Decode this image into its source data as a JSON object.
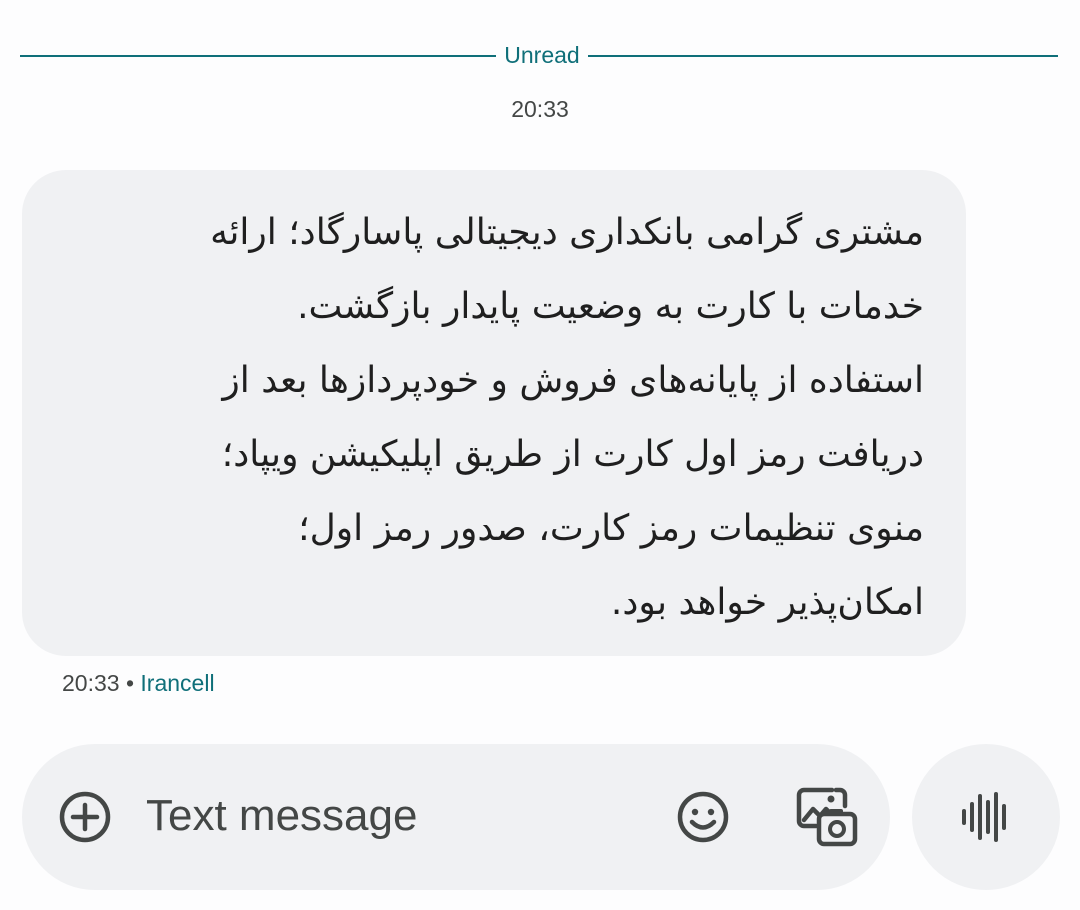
{
  "divider": {
    "label": "Unread"
  },
  "conversation": {
    "timestamp": "20:33",
    "message": {
      "text": "مشتری گرامی بانکداری دیجیتالی پاسارگاد؛ ارائه\nخدمات با کارت به وضعیت پایدار بازگشت.\nاستفاده از پایانه‌های فروش و خودپردازها بعد از\nدریافت رمز اول کارت از طریق اپلیکیشن ویپاد؛\nمنوی تنظیمات رمز کارت، صدور رمز اول؛\nامکان‌پذیر خواهد بود.",
      "time": "20:33",
      "separator": "•",
      "sender": "Irancell"
    }
  },
  "composer": {
    "placeholder": "Text message",
    "add_icon": "plus-circle-icon",
    "emoji_icon": "emoji-icon",
    "gallery_icon": "gallery-camera-icon",
    "voice_icon": "voice-waveform-icon"
  },
  "colors": {
    "accent": "#0f6f79",
    "bubble": "#f0f1f3",
    "text": "#1f1f1f",
    "secondary_text": "#444746"
  }
}
